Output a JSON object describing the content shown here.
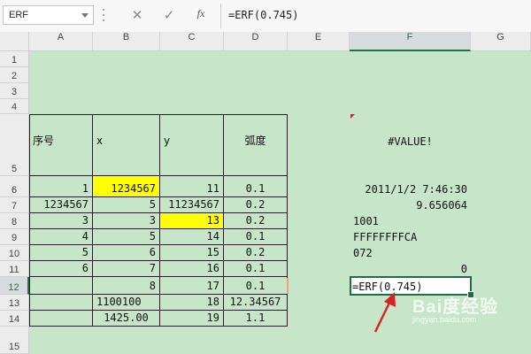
{
  "formula_bar": {
    "name_box": "ERF",
    "cancel_icon": "✕",
    "enter_icon": "✓",
    "fx_label": "fx",
    "formula": "=ERF(0.745)"
  },
  "columns": [
    "A",
    "B",
    "C",
    "D",
    "E",
    "F",
    "G"
  ],
  "rows": [
    "1",
    "2",
    "3",
    "4",
    "5",
    "6",
    "7",
    "8",
    "9",
    "10",
    "11",
    "12",
    "13",
    "14",
    "15"
  ],
  "cells": {
    "A5": "序号",
    "B5": "x",
    "C5": "y",
    "D5": "弧度",
    "F5": "#VALUE!",
    "A6": "1",
    "B6": "1234567",
    "C6": "11",
    "D6": "0.1",
    "F6": "2011/1/2 7:46:30",
    "A7": "1234567",
    "B7": "5",
    "C7": "11234567",
    "D7": "0.2",
    "F7": "9.656064",
    "A8": "3",
    "B8": "3",
    "C8": "13",
    "D8": "0.2",
    "F8": "1001",
    "A9": "4",
    "B9": "5",
    "C9": "14",
    "D9": "0.1",
    "F9": "FFFFFFFFCA",
    "A10": "5",
    "B10": "6",
    "C10": "15",
    "D10": "0.2",
    "F10": "072",
    "A11": "6",
    "B11": "7",
    "C11": "16",
    "D11": "0.1",
    "F11": "0",
    "B12": "8",
    "C12": "17",
    "D12": "0.1",
    "F12": "=ERF(0.745)",
    "B13": "1100100",
    "C13": "18",
    "D13": "12.34567",
    "B14": "1425.00",
    "C14": "19",
    "D14": "1.1"
  },
  "selection": {
    "active_cell": "F12",
    "selected_column": "F",
    "selected_row": "12"
  },
  "colors": {
    "sheet_bg": "#c7e6c9",
    "highlight": "#ffff00",
    "active_border": "#1f6e43",
    "annotation_arrow": "#e02020"
  },
  "watermark": {
    "main": "Bai度经验",
    "sub": "jingyan.baidu.com"
  }
}
